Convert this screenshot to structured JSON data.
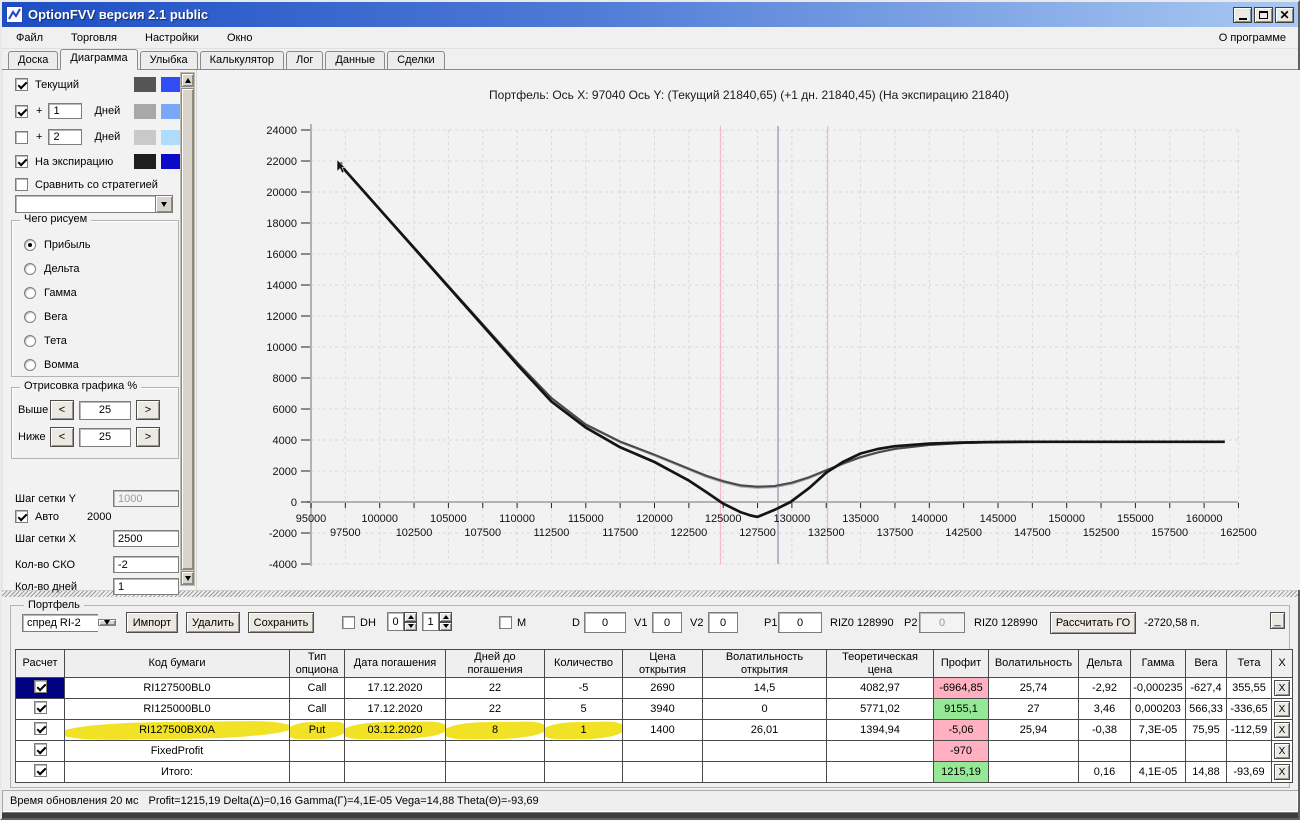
{
  "window": {
    "title": "OptionFVV версия 2.1 public"
  },
  "menu": {
    "items": [
      "Файл",
      "Торговля",
      "Настройки",
      "Окно"
    ],
    "right_item": "О программе"
  },
  "tabs": {
    "items": [
      "Доска",
      "Диаграмма",
      "Улыбка",
      "Калькулятор",
      "Лог",
      "Данные",
      "Сделки"
    ],
    "active": "Диаграмма"
  },
  "left_panel": {
    "legend": [
      {
        "key": "current",
        "checked": true,
        "prefix": "",
        "days": "",
        "label": "Текущий",
        "color1": "#555555",
        "color2": "#2f4df2"
      },
      {
        "key": "plus-1-day",
        "checked": true,
        "prefix": "+",
        "days": "1",
        "label": "Дней",
        "color1": "#a8a8a8",
        "color2": "#7aa7f7"
      },
      {
        "key": "plus-2-days",
        "checked": false,
        "prefix": "+",
        "days": "2",
        "label": "Дней",
        "color1": "#c9c9c9",
        "color2": "#aedcfc"
      },
      {
        "key": "expiration",
        "checked": true,
        "prefix": "",
        "days": "",
        "label": "На экспирацию",
        "color1": "#1e1e1e",
        "color2": "#0a0ac8"
      }
    ],
    "compare": {
      "checked": false,
      "label": "Сравнить со стратегией",
      "dropdown_value": ""
    },
    "draw_group": {
      "title": "Чего рисуем",
      "options": [
        "Прибыль",
        "Дельта",
        "Гамма",
        "Вега",
        "Тета",
        "Вомма"
      ],
      "selected": "Прибыль"
    },
    "render_group": {
      "title": "Отрисовка графика %",
      "rows": [
        {
          "label": "Выше",
          "value": "25"
        },
        {
          "label": "Ниже",
          "value": "25"
        }
      ]
    },
    "grid_settings": [
      {
        "label": "Шаг сетки Y",
        "value": "1000",
        "disabled": true
      },
      {
        "label": "Авто",
        "checked": true,
        "extra": "2000"
      },
      {
        "label": "Шаг сетки X",
        "value": "2500",
        "disabled": false
      },
      {
        "label": "Кол-во СКО",
        "value": "-2",
        "disabled": false
      },
      {
        "label": "Кол-во дней",
        "value": "1",
        "disabled": false
      }
    ]
  },
  "chart_data": {
    "type": "line",
    "title": "Портфель: Ось X: 97040 Ось Y:  (Текущий 21840,65)  (+1 дн. 21840,45)  (На экспирацию 21840)",
    "xlabel": "",
    "ylabel": "",
    "x_range": [
      95000,
      162500
    ],
    "y_range": [
      -4000,
      24000
    ],
    "x_tick_step": 2500,
    "y_tick_step": 2000,
    "grid": true,
    "y_ticks": [
      24000,
      22000,
      20000,
      18000,
      16000,
      14000,
      12000,
      10000,
      8000,
      6000,
      4000,
      2000,
      0,
      -2000,
      -4000
    ],
    "x_ticks_row1": [
      95000,
      100000,
      105000,
      110000,
      115000,
      120000,
      125000,
      130000,
      135000,
      140000,
      145000,
      150000,
      155000,
      160000
    ],
    "x_ticks_row2": [
      97500,
      102500,
      107500,
      112500,
      117500,
      122500,
      127500,
      132500,
      137500,
      142500,
      147500,
      152500,
      157500,
      162500
    ],
    "reference_lines": [
      {
        "x": 124800,
        "color": "#f3b9c5",
        "name": "sko-lower-line"
      },
      {
        "x": 128990,
        "color": "#8795af",
        "name": "underlying-price-line"
      },
      {
        "x": 132600,
        "color": "#f3b9c5",
        "name": "sko-upper-line"
      }
    ],
    "start_marker": {
      "x": 97040,
      "y": 21840
    },
    "series": [
      {
        "name": "+1 день",
        "color": "#a9a9a9",
        "width": 1.5,
        "points": [
          [
            97040,
            21845
          ],
          [
            100000,
            18885
          ],
          [
            102500,
            16405
          ],
          [
            105000,
            13925
          ],
          [
            107500,
            11445
          ],
          [
            110000,
            8980
          ],
          [
            112500,
            6660
          ],
          [
            115000,
            4950
          ],
          [
            117500,
            3840
          ],
          [
            120000,
            2980
          ],
          [
            121250,
            2530
          ],
          [
            122500,
            2070
          ],
          [
            123750,
            1620
          ],
          [
            125000,
            1260
          ],
          [
            126250,
            990
          ],
          [
            127500,
            900
          ],
          [
            128750,
            940
          ],
          [
            130000,
            1160
          ],
          [
            131250,
            1520
          ],
          [
            132500,
            1980
          ],
          [
            133750,
            2440
          ],
          [
            135000,
            2850
          ],
          [
            136250,
            3160
          ],
          [
            137500,
            3400
          ],
          [
            140000,
            3660
          ],
          [
            142500,
            3795
          ],
          [
            145000,
            3855
          ],
          [
            147500,
            3880
          ],
          [
            150000,
            3885
          ],
          [
            155000,
            3885
          ],
          [
            161500,
            3885
          ]
        ]
      },
      {
        "name": "Текущий",
        "color": "#4a4a4a",
        "width": 2.1,
        "points": [
          [
            97040,
            21865
          ],
          [
            100000,
            18905
          ],
          [
            102500,
            16425
          ],
          [
            105000,
            13945
          ],
          [
            107500,
            11465
          ],
          [
            110000,
            9000
          ],
          [
            112500,
            6700
          ],
          [
            115000,
            5000
          ],
          [
            117500,
            3900
          ],
          [
            120000,
            3050
          ],
          [
            121250,
            2600
          ],
          [
            122500,
            2150
          ],
          [
            123750,
            1700
          ],
          [
            125000,
            1350
          ],
          [
            126250,
            1080
          ],
          [
            127500,
            990
          ],
          [
            128750,
            1030
          ],
          [
            130000,
            1250
          ],
          [
            131250,
            1600
          ],
          [
            132500,
            2050
          ],
          [
            133750,
            2500
          ],
          [
            135000,
            2900
          ],
          [
            136250,
            3200
          ],
          [
            137500,
            3430
          ],
          [
            140000,
            3680
          ],
          [
            142500,
            3810
          ],
          [
            145000,
            3865
          ],
          [
            147500,
            3885
          ],
          [
            150000,
            3890
          ],
          [
            155000,
            3890
          ],
          [
            161500,
            3890
          ]
        ]
      },
      {
        "name": "На экспирацию",
        "color": "#141414",
        "width": 2.7,
        "points": [
          [
            97040,
            21840
          ],
          [
            100000,
            18880
          ],
          [
            102500,
            16380
          ],
          [
            105000,
            13880
          ],
          [
            107500,
            11380
          ],
          [
            110000,
            8880
          ],
          [
            112500,
            6480
          ],
          [
            115000,
            4800
          ],
          [
            117500,
            3530
          ],
          [
            120000,
            2580
          ],
          [
            121250,
            1980
          ],
          [
            122500,
            1380
          ],
          [
            123750,
            650
          ],
          [
            125000,
            -100
          ],
          [
            126250,
            -650
          ],
          [
            127000,
            -870
          ],
          [
            127500,
            -960
          ],
          [
            128750,
            -500
          ],
          [
            129900,
            0
          ],
          [
            131250,
            900
          ],
          [
            132500,
            1900
          ],
          [
            133750,
            2600
          ],
          [
            135000,
            3130
          ],
          [
            136250,
            3420
          ],
          [
            137500,
            3600
          ],
          [
            140000,
            3770
          ],
          [
            142500,
            3840
          ],
          [
            145000,
            3870
          ],
          [
            147500,
            3885
          ],
          [
            150000,
            3885
          ],
          [
            155000,
            3885
          ],
          [
            161500,
            3885
          ]
        ]
      }
    ]
  },
  "portfolio": {
    "group_title": "Портфель",
    "toolbar": {
      "preset": "спред RI-2",
      "buttons": [
        "Импорт",
        "Удалить",
        "Сохранить"
      ],
      "dh_label": "DH",
      "dh_checked": false,
      "spin1": "0",
      "spin2": "1",
      "m_label": "M",
      "m_checked": false,
      "d_label": "D",
      "d_value": "0",
      "v1_label": "V1",
      "v1_value": "0",
      "v2_label": "V2",
      "v2_value": "0",
      "p1_label": "P1",
      "p1_value": "0",
      "riz1": "RIZ0 128990",
      "p2_label": "P2",
      "p2_value": "0",
      "riz2": "RIZ0 128990",
      "calc_button": "Рассчитать ГО",
      "go_value": "-2720,58 п.",
      "collapse_button": "_"
    },
    "table": {
      "columns": [
        "Расчет",
        "Код бумаги",
        "Тип опциона",
        "Дата погашения",
        "Дней до погашения",
        "Количество",
        "Цена открытия",
        "Волатильность открытия",
        "Теоретическая цена",
        "Профит",
        "Волатильность",
        "Дельта",
        "Гамма",
        "Вега",
        "Тета",
        "X"
      ],
      "delete_label": "X",
      "rows": [
        {
          "checked": true,
          "selected": true,
          "highlighted": false,
          "code": "RI127500BL0",
          "type": "Call",
          "date": "17.12.2020",
          "days": "22",
          "qty": "-5",
          "open": "2690",
          "open_vol": "14,5",
          "theo": "4082,97",
          "profit": "-6964,85",
          "profit_state": "neg",
          "vol": "25,74",
          "delta": "-2,92",
          "gamma": "-0,000235",
          "vega": "-627,4",
          "theta": "355,55"
        },
        {
          "checked": true,
          "selected": false,
          "highlighted": false,
          "code": "RI125000BL0",
          "type": "Call",
          "date": "17.12.2020",
          "days": "22",
          "qty": "5",
          "open": "3940",
          "open_vol": "0",
          "theo": "5771,02",
          "profit": "9155,1",
          "profit_state": "pos",
          "vol": "27",
          "delta": "3,46",
          "gamma": "0,000203",
          "vega": "566,33",
          "theta": "-336,65"
        },
        {
          "checked": true,
          "selected": false,
          "highlighted": true,
          "code": "RI127500BX0A",
          "type": "Put",
          "date": "03.12.2020",
          "days": "8",
          "qty": "1",
          "open": "1400",
          "open_vol": "26,01",
          "theo": "1394,94",
          "profit": "-5,06",
          "profit_state": "neg",
          "vol": "25,94",
          "delta": "-0,38",
          "gamma": "7,3E-05",
          "vega": "75,95",
          "theta": "-112,59"
        },
        {
          "checked": true,
          "selected": false,
          "highlighted": false,
          "code": "FixedProfit",
          "type": "",
          "date": "",
          "days": "",
          "qty": "",
          "open": "",
          "open_vol": "",
          "theo": "",
          "profit": "-970",
          "profit_state": "neg",
          "vol": "",
          "delta": "",
          "gamma": "",
          "vega": "",
          "theta": ""
        },
        {
          "checked": true,
          "selected": false,
          "highlighted": false,
          "code": "Итого:",
          "type": "",
          "date": "",
          "days": "",
          "qty": "",
          "open": "",
          "open_vol": "",
          "theo": "",
          "profit": "1215,19",
          "profit_state": "pos",
          "vol": "",
          "delta": "0,16",
          "gamma": "4,1E-05",
          "vega": "14,88",
          "theta": "-93,69"
        }
      ]
    }
  },
  "status": {
    "left": "Время обновления 20 мс",
    "right": "Profit=1215,19 Delta(Δ)=0,16 Gamma(Γ)=4,1E-05 Vega=14,88 Theta(Θ)=-93,69"
  },
  "colors": {
    "profit_pos": "#95e895",
    "profit_neg": "#ffb1c1",
    "highlight": "#f0df12",
    "titlebar_from": "#1c4ec4",
    "titlebar_to": "#a9c9f2",
    "selected_cell": "#000080"
  }
}
